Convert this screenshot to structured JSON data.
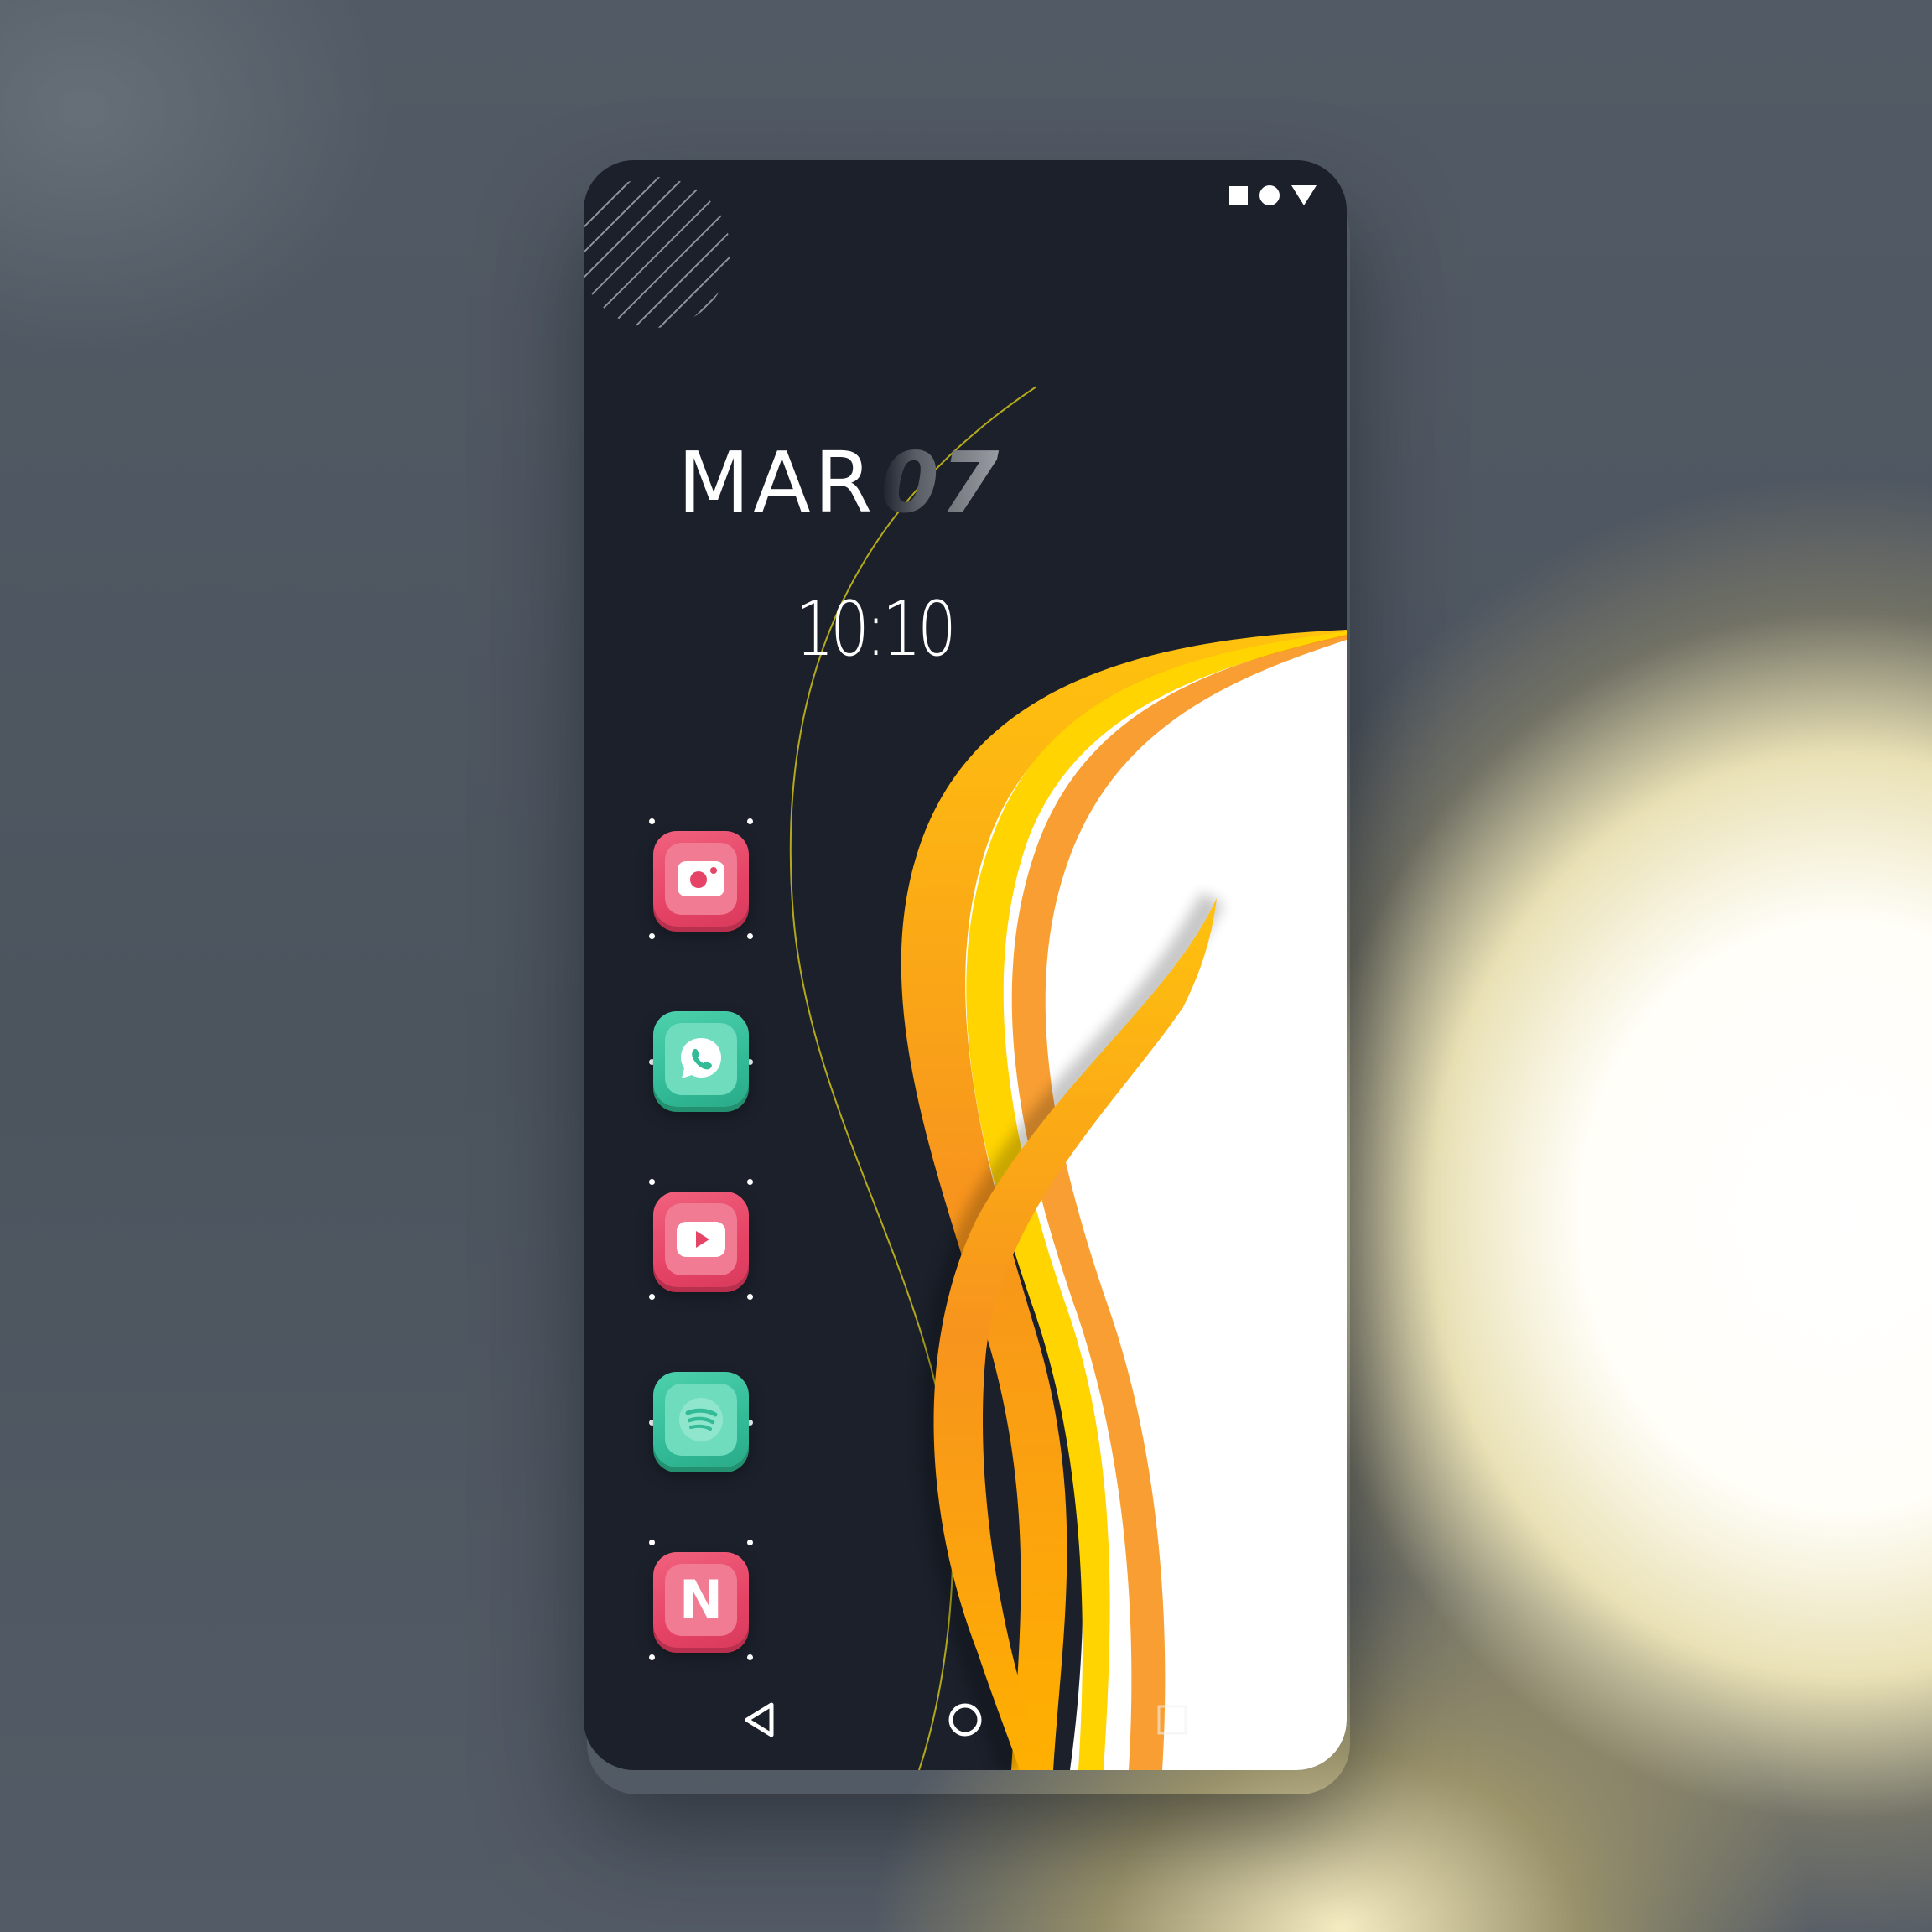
{
  "status_bar": {
    "icons": [
      "square-icon",
      "dot-icon",
      "triangle-signal-icon"
    ],
    "color": "#ffffff"
  },
  "clock_widget": {
    "month": "MAR",
    "day": "07",
    "time": "10:10"
  },
  "dock": {
    "apps": [
      {
        "icon": "instagram-icon",
        "color": "#e64466"
      },
      {
        "icon": "whatsapp-icon",
        "color": "#33bb97"
      },
      {
        "icon": "youtube-icon",
        "color": "#e64466"
      },
      {
        "icon": "spotify-icon",
        "color": "#33bb97"
      },
      {
        "icon": "netflix-icon",
        "letter": "N",
        "color": "#e64466"
      }
    ]
  },
  "nav_bar": {
    "buttons": [
      "back-triangle-icon",
      "home-circle-icon",
      "recents-square-icon"
    ]
  },
  "theme": {
    "background": "#1b202b",
    "accent_orange": "#f7941d",
    "accent_yellow": "#ffd400",
    "text": "#ffffff"
  }
}
